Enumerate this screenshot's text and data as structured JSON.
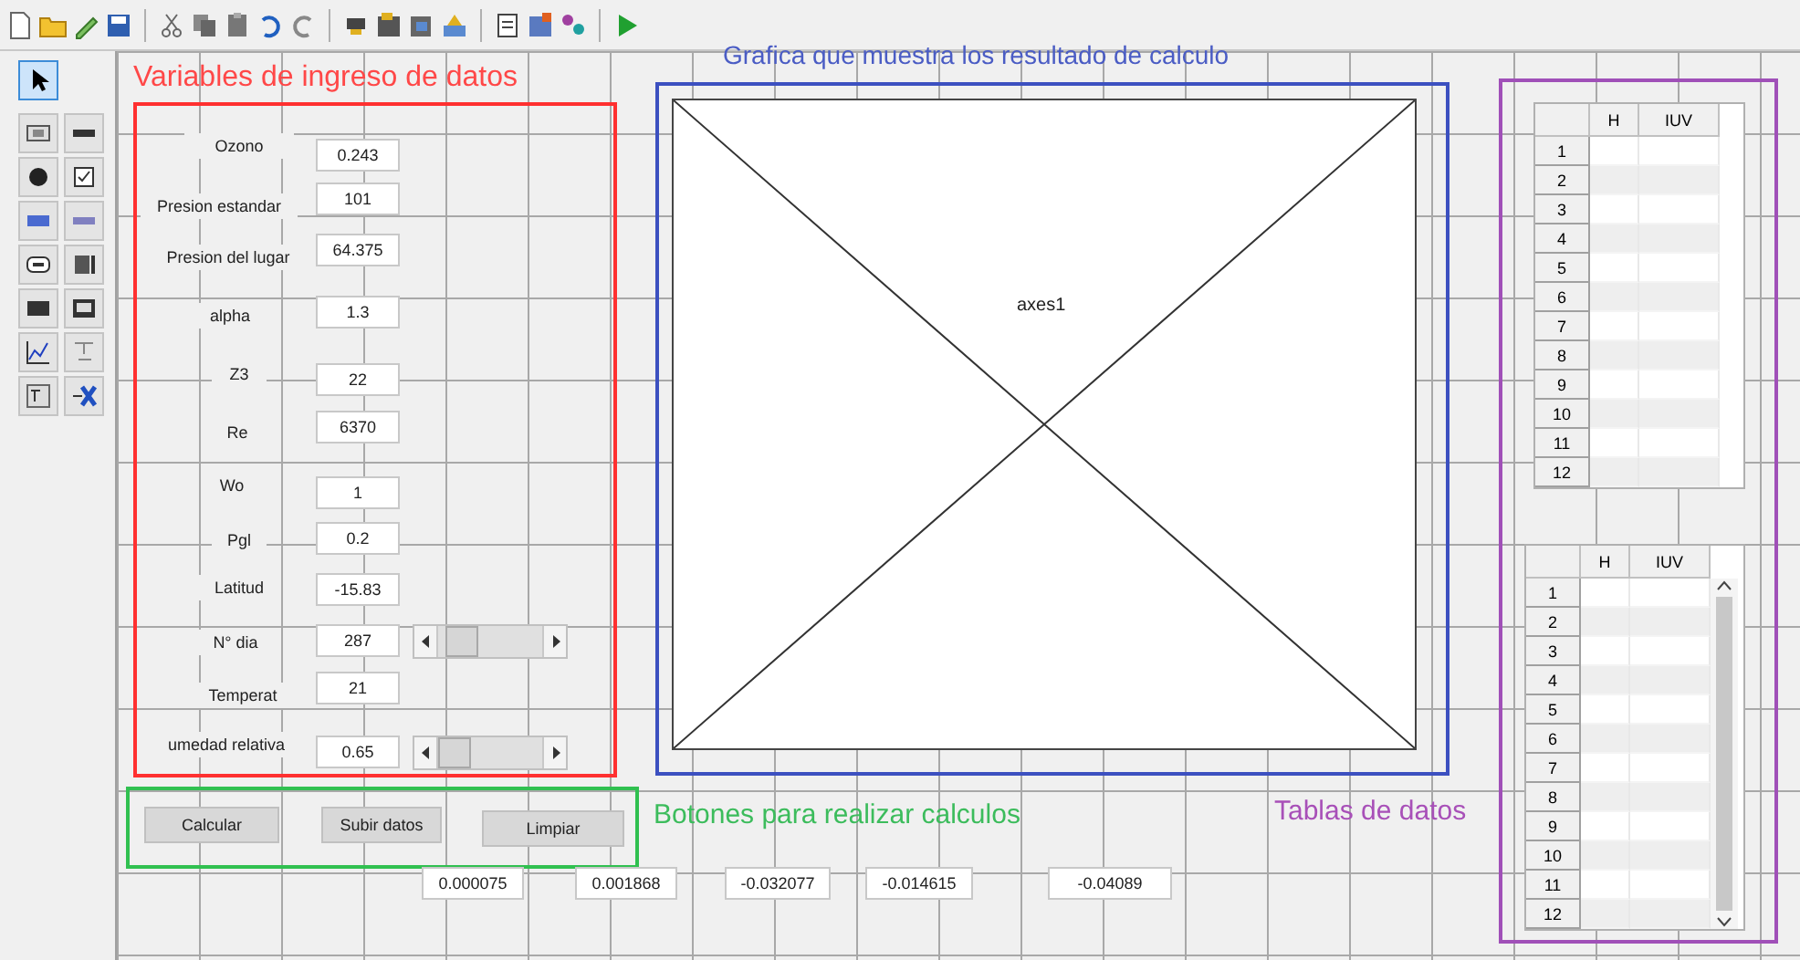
{
  "tools": [
    {
      "selected": true
    },
    {
      "selected": false
    },
    {
      "selected": false
    },
    {
      "selected": false
    },
    {
      "selected": false
    },
    {
      "selected": false
    },
    {
      "selected": false
    },
    {
      "selected": false
    },
    {
      "selected": false
    },
    {
      "selected": false
    },
    {
      "selected": false
    },
    {
      "selected": false
    },
    {
      "selected": false
    },
    {
      "selected": false
    },
    {
      "selected": false
    }
  ],
  "inputs_panel": {
    "title": "Variables de ingreso de datos",
    "fields": [
      {
        "label": "Ozono",
        "value": "0.243"
      },
      {
        "label": "Presion estandar",
        "value": "101"
      },
      {
        "label": "Presion del lugar",
        "value": "64.375"
      },
      {
        "label": "alpha",
        "value": "1.3"
      },
      {
        "label": "Z3",
        "value": "22"
      },
      {
        "label": "Re",
        "value": "6370"
      },
      {
        "label": "Wo",
        "value": "1"
      },
      {
        "label": "Pgl",
        "value": "0.2"
      },
      {
        "label": "Latitud",
        "value": "-15.83"
      },
      {
        "label": "N° dia",
        "value": "287",
        "slider": {
          "level": 0.1
        }
      },
      {
        "label": "Temperat",
        "value": "21"
      },
      {
        "label": "umedad relativa",
        "value": "0.65",
        "slider": {
          "level": 0.0
        }
      }
    ]
  },
  "graph_panel": {
    "title": "Grafica que muestra los resultado de calculo",
    "axes_label": "axes1"
  },
  "buttons_panel": {
    "title": "Botones para realizar calculos",
    "buttons": [
      "Calcular",
      "Subir datos",
      "Limpiar"
    ]
  },
  "results": [
    "0.000075",
    "0.001868",
    "-0.032077",
    "-0.014615",
    "-0.04089"
  ],
  "tables_panel": {
    "title": "Tablas de datos",
    "tables": [
      {
        "kind": "plain",
        "columns": [
          "H",
          "IUV"
        ],
        "rows": [
          "1",
          "2",
          "3",
          "4",
          "5",
          "6",
          "7",
          "8",
          "9",
          "10",
          "11",
          "12"
        ]
      },
      {
        "kind": "scrolling",
        "columns": [
          "H",
          "IUV"
        ],
        "rows": [
          "1",
          "2",
          "3",
          "4",
          "5",
          "6",
          "7",
          "8",
          "9",
          "10",
          "11",
          "12"
        ]
      }
    ]
  }
}
